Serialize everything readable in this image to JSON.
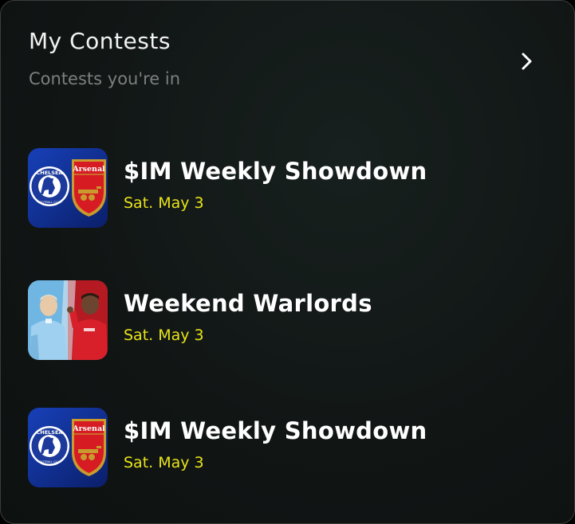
{
  "header": {
    "title": "My Contests",
    "subtitle": "Contests you're in"
  },
  "contests": [
    {
      "name": "$IM Weekly Showdown",
      "date": "Sat. May 3",
      "thumb": "chelsea-arsenal-crests"
    },
    {
      "name": "Weekend Warlords",
      "date": "Sat. May 3",
      "thumb": "man-city-man-united-players"
    },
    {
      "name": "$IM Weekly Showdown",
      "date": "Sat. May 3",
      "thumb": "chelsea-arsenal-crests"
    }
  ],
  "badge_text": {
    "chelsea": "CHELSEA",
    "chelsea_ring": "FOOTBALL CLUB",
    "arsenal": "Arsenal"
  },
  "colors": {
    "date": "#e9e41a",
    "chelsea_blue": "#1c3a9c",
    "arsenal_red": "#d61b23"
  }
}
